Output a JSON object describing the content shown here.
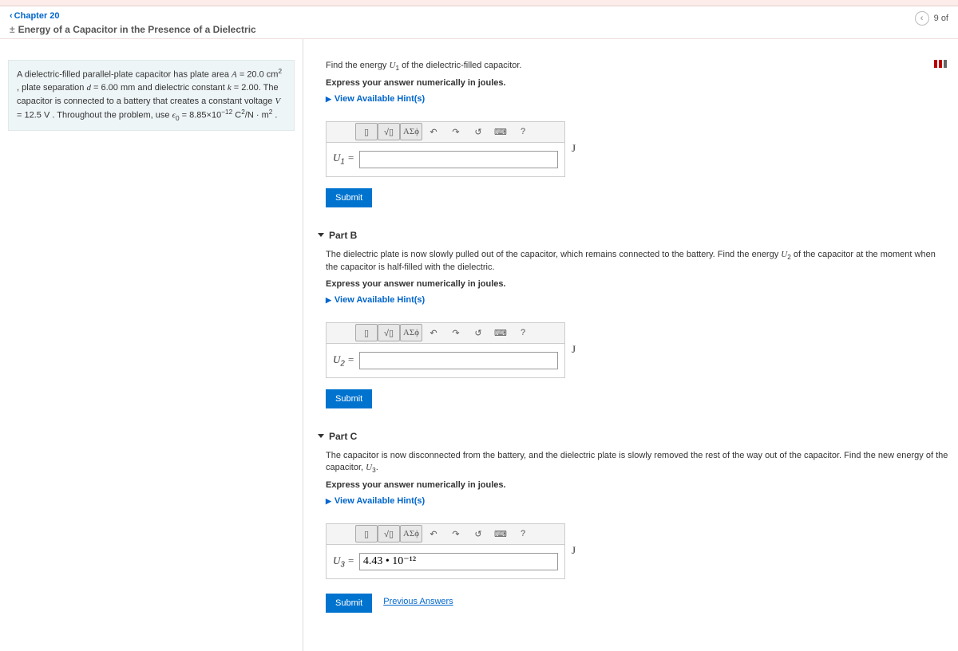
{
  "nav": {
    "breadcrumb": "Chapter 20",
    "title": "Energy of a Capacitor in the Presence of a Dielectric",
    "progress": "9 of"
  },
  "problem": {
    "text_html": "A dielectric-filled parallel-plate capacitor has plate area <span class='it'>A</span> = 20.0 cm<sup>2</sup> , plate separation <span class='it'>d</span> = 6.00 mm and dielectric constant <span class='it'>k</span> = 2.00. The capacitor is connected to a battery that creates a constant voltage <span class='it'>V</span> = 12.5 V . Throughout the problem, use <span class='it'>ϵ</span><sub>0</sub> = 8.85×10<sup>−12</sup> C<sup>2</sup>/N · m<sup>2</sup> ."
  },
  "toolbar": {
    "templates": "▯",
    "sqrt": "√▯",
    "greek": "ΑΣϕ",
    "undo": "↶",
    "redo": "↷",
    "reset": "↺",
    "keyboard": "⌨",
    "help": "?"
  },
  "parts": {
    "a": {
      "prompt_html": "Find the energy <span class='it'>U</span><sub>1</sub> of the dielectric-filled capacitor.",
      "instr": "Express your answer numerically in joules.",
      "hints": "View Available Hint(s)",
      "var_html": "<span class='it'>U</span><sub>1</sub> =",
      "value": "",
      "unit": "J",
      "submit": "Submit"
    },
    "b": {
      "header": "Part B",
      "prompt_html": "The dielectric plate is now slowly pulled out of the capacitor, which remains connected to the battery. Find the energy <span class='it'>U</span><sub>2</sub> of the capacitor at the moment when the capacitor is half-filled with the dielectric.",
      "instr": "Express your answer numerically in joules.",
      "hints": "View Available Hint(s)",
      "var_html": "<span class='it'>U</span><sub>2</sub> =",
      "value": "",
      "unit": "J",
      "submit": "Submit"
    },
    "c": {
      "header": "Part C",
      "prompt_html": "The capacitor is now disconnected from the battery, and the dielectric plate is slowly removed the rest of the way out of the capacitor. Find the new energy of the capacitor, <span class='it'>U</span><sub>3</sub>.",
      "instr": "Express your answer numerically in joules.",
      "hints": "View Available Hint(s)",
      "var_html": "<span class='it'>U</span><sub>3</sub> =",
      "value": "4.43 • 10⁻¹²",
      "unit": "J",
      "submit": "Submit",
      "prev": "Previous Answers"
    }
  }
}
